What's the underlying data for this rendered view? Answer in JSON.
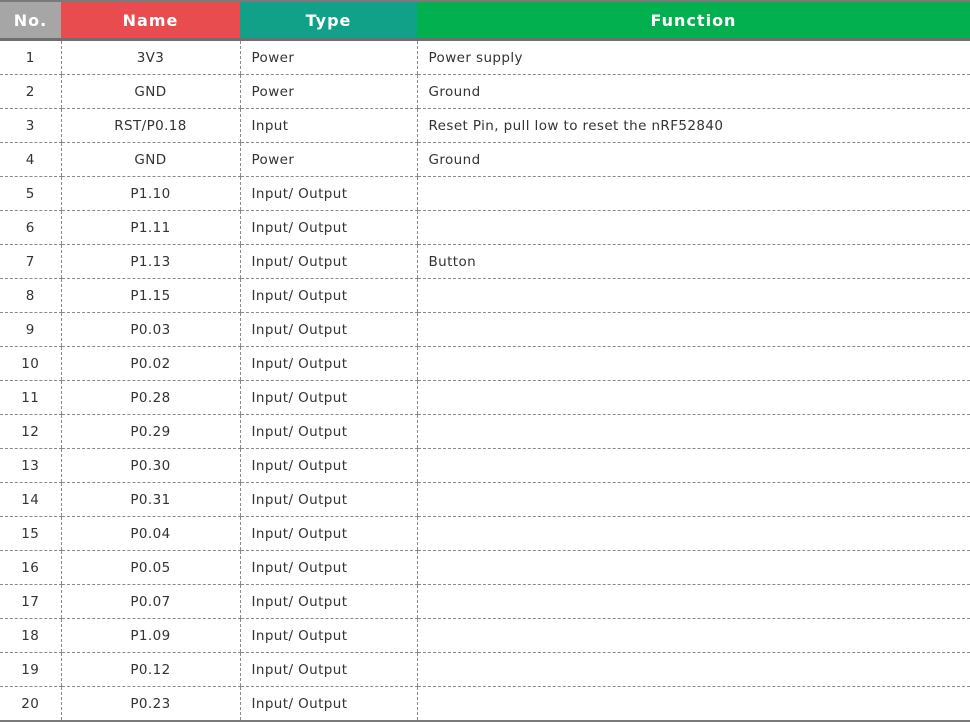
{
  "table": {
    "headers": {
      "no": "No.",
      "name": "Name",
      "type": "Type",
      "function": "Function"
    },
    "header_colors": {
      "no": "#a6a6a6",
      "name": "#e84c4f",
      "type": "#11a189",
      "function": "#02b050"
    },
    "rows": [
      {
        "no": "1",
        "name": "3V3",
        "type": "Power",
        "function": "Power supply"
      },
      {
        "no": "2",
        "name": "GND",
        "type": "Power",
        "function": "Ground"
      },
      {
        "no": "3",
        "name": "RST/P0.18",
        "type": "Input",
        "function": "Reset Pin, pull low to reset the nRF52840"
      },
      {
        "no": "4",
        "name": "GND",
        "type": "Power",
        "function": "Ground"
      },
      {
        "no": "5",
        "name": "P1.10",
        "type": "Input/ Output",
        "function": ""
      },
      {
        "no": "6",
        "name": "P1.11",
        "type": "Input/ Output",
        "function": ""
      },
      {
        "no": "7",
        "name": "P1.13",
        "type": "Input/ Output",
        "function": "Button"
      },
      {
        "no": "8",
        "name": "P1.15",
        "type": "Input/ Output",
        "function": ""
      },
      {
        "no": "9",
        "name": "P0.03",
        "type": "Input/ Output",
        "function": ""
      },
      {
        "no": "10",
        "name": "P0.02",
        "type": "Input/ Output",
        "function": ""
      },
      {
        "no": "11",
        "name": "P0.28",
        "type": "Input/ Output",
        "function": ""
      },
      {
        "no": "12",
        "name": "P0.29",
        "type": "Input/ Output",
        "function": ""
      },
      {
        "no": "13",
        "name": "P0.30",
        "type": "Input/ Output",
        "function": ""
      },
      {
        "no": "14",
        "name": "P0.31",
        "type": "Input/ Output",
        "function": ""
      },
      {
        "no": "15",
        "name": "P0.04",
        "type": "Input/ Output",
        "function": ""
      },
      {
        "no": "16",
        "name": "P0.05",
        "type": "Input/ Output",
        "function": ""
      },
      {
        "no": "17",
        "name": "P0.07",
        "type": "Input/ Output",
        "function": ""
      },
      {
        "no": "18",
        "name": "P1.09",
        "type": "Input/ Output",
        "function": ""
      },
      {
        "no": "19",
        "name": "P0.12",
        "type": "Input/ Output",
        "function": ""
      },
      {
        "no": "20",
        "name": "P0.23",
        "type": "Input/ Output",
        "function": ""
      }
    ]
  }
}
